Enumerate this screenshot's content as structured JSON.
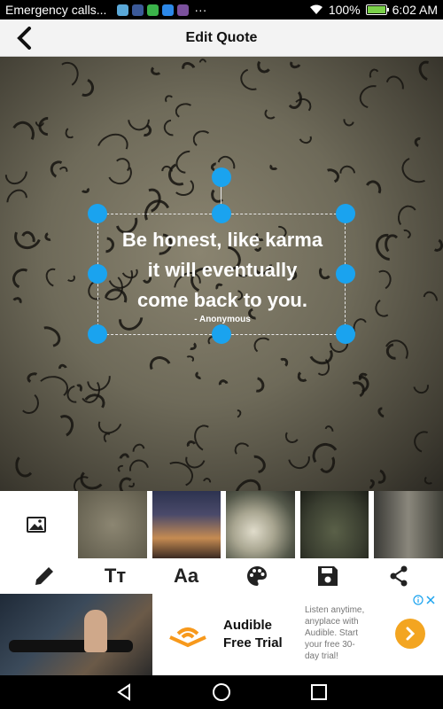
{
  "status_bar": {
    "carrier_text": "Emergency calls...",
    "battery_percent": "100%",
    "battery_level": 1.0,
    "time": "6:02 AM",
    "notification_icons": [
      "messages-icon",
      "facebook-icon",
      "hangouts-icon",
      "messenger-icon",
      "viber-icon"
    ],
    "more": "···"
  },
  "app_bar": {
    "title": "Edit Quote"
  },
  "quote": {
    "text_lines": [
      "Be honest, like karma",
      "it will eventually",
      "come back to you."
    ],
    "author": "- Anonymous"
  },
  "toolbar_icons": [
    "edit-pencil-icon",
    "text-size-icon",
    "font-icon",
    "color-palette-icon",
    "save-icon",
    "share-icon"
  ],
  "toolbar": {
    "text_size_label": "Tт",
    "font_label": "Aa"
  },
  "ad": {
    "title_line1": "Audible",
    "title_line2": "Free Trial",
    "desc_lines": [
      "Listen anytime,",
      "anyplace with",
      "Audible. Start",
      "your free 30-",
      "day trial!"
    ]
  },
  "colors": {
    "handle": "#1aa3ef",
    "ad_cta": "#f3a521",
    "audible_orange": "#f7991c"
  }
}
